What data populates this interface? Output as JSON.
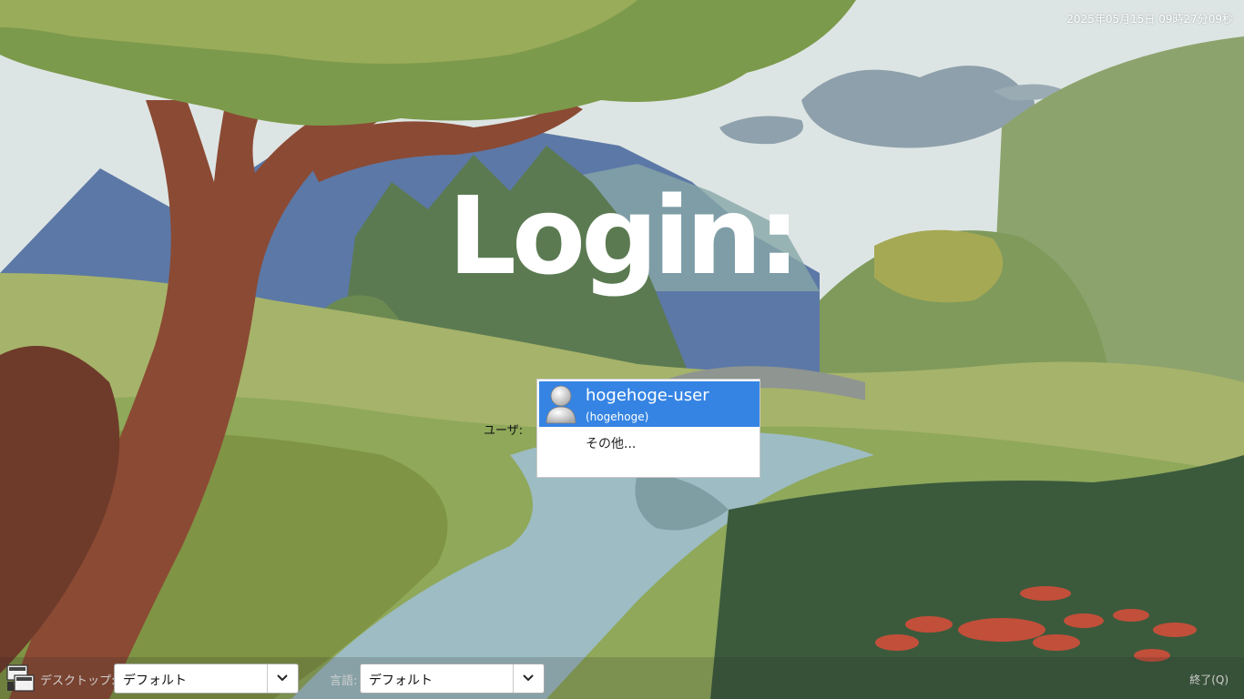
{
  "clock": {
    "text": "2025年05月15日 09時27分09秒"
  },
  "title": "Login:",
  "user_selector": {
    "label": "ユーザ:",
    "users": [
      {
        "name": "hogehoge-user",
        "login": "(hogehoge)",
        "selected": true
      }
    ],
    "other_label": "その他..."
  },
  "bottom_bar": {
    "desktop": {
      "label": "デスクトップ:",
      "value": "デフォルト"
    },
    "language": {
      "label": "言語:",
      "value": "デフォルト"
    },
    "quit_label": "終了(Q)"
  },
  "colors": {
    "selection": "#3584e4"
  }
}
